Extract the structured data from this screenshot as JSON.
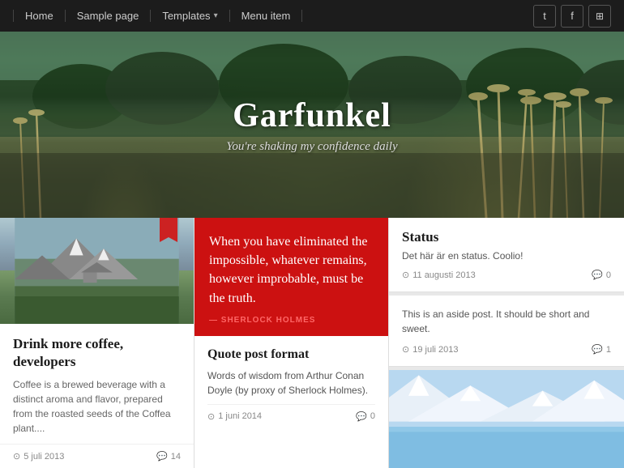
{
  "nav": {
    "items": [
      {
        "label": "Home",
        "has_arrow": false
      },
      {
        "label": "Sample page",
        "has_arrow": false
      },
      {
        "label": "Templates",
        "has_arrow": true
      },
      {
        "label": "Menu item",
        "has_arrow": false
      }
    ],
    "social": [
      {
        "icon": "𝕏",
        "name": "twitter"
      },
      {
        "icon": "f",
        "name": "facebook"
      },
      {
        "icon": "◉",
        "name": "instagram"
      }
    ]
  },
  "hero": {
    "title": "Garfunkel",
    "subtitle": "You're shaking my confidence daily"
  },
  "cards": {
    "left": {
      "title": "Drink more coffee, developers",
      "text": "Coffee is a brewed beverage with a distinct aroma and flavor, prepared from the roasted seeds of the Coffea plant....",
      "date": "5 juli 2013",
      "comments": "14"
    },
    "middle": {
      "red_text": "When you have eliminated the impossible, whatever remains, however improbable, must be the truth.",
      "red_author": "— Sherlock Holmes",
      "quote_title": "Quote post format",
      "quote_text": "Words of wisdom from Arthur Conan Doyle (by proxy of Sherlock Holmes).",
      "quote_date": "1 juni 2014",
      "quote_comments": "0"
    },
    "right": {
      "status_title": "Status",
      "status_text": "Det här är en status. Coolio!",
      "status_date": "11 augusti 2013",
      "status_comments": "0",
      "aside_text": "This is an aside post. It should be short and sweet.",
      "aside_date": "19 juli 2013",
      "aside_comments": "1"
    }
  }
}
